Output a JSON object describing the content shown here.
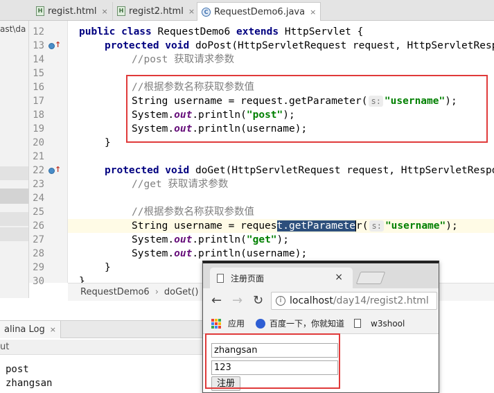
{
  "ide": {
    "tabs": [
      {
        "label": "regist.html",
        "type": "H"
      },
      {
        "label": "regist2.html",
        "type": "H"
      },
      {
        "label": "RequestDemo6.java",
        "type": "C"
      }
    ],
    "tab_close": "×",
    "project_path_stub": "ast\\da",
    "breadcrumb": {
      "class_name": "RequestDemo6",
      "separator": "›",
      "method": "doGet()"
    },
    "console": {
      "tab_label": "alina Log",
      "tab_close": "×",
      "header": "ut",
      "output": [
        "post",
        "zhangsan"
      ]
    }
  },
  "code": {
    "line_numbers": [
      "12",
      "13",
      "14",
      "15",
      "16",
      "17",
      "18",
      "19",
      "20",
      "21",
      "22",
      "23",
      "24",
      "25",
      "26",
      "27",
      "28",
      "29",
      "30"
    ],
    "l12": {
      "kw1": "public class",
      "cls": " RequestDemo6 ",
      "kw2": "extends",
      "rest": " HttpServlet {"
    },
    "l13": {
      "kw": "protected void",
      "rest": " doPost(HttpServletRequest request, HttpServletResponse response)"
    },
    "l14": {
      "comment": "//post 获取请求参数"
    },
    "l16": {
      "comment": "//根据参数名称获取参数值"
    },
    "l17": {
      "a": "String username = request.getParameter(",
      "hint": "s:",
      "str": "\"username\"",
      "b": ");"
    },
    "l18": {
      "a": "System.",
      "field": "out",
      "b": ".println(",
      "str": "\"post\"",
      "c": ");"
    },
    "l19": {
      "a": "System.",
      "field": "out",
      "b": ".println(username);"
    },
    "l20": {
      "brace": "}"
    },
    "l22": {
      "kw": "protected void",
      "rest": " doGet(HttpServletRequest request, HttpServletResponse response)"
    },
    "l23": {
      "comment": "//get 获取请求参数"
    },
    "l25": {
      "comment": "//根据参数名称获取参数值"
    },
    "l26": {
      "a": "String username = reques",
      "sel": "t.getParamete",
      "b": "r(",
      "hint": "s:",
      "str": "\"username\"",
      "c": ");"
    },
    "l27": {
      "a": "System.",
      "field": "out",
      "b": ".println(",
      "str": "\"get\"",
      "c": ");"
    },
    "l28": {
      "a": "System.",
      "field": "out",
      "b": ".println(username);"
    },
    "l29": {
      "brace": "}"
    },
    "l30": {
      "brace": "}"
    }
  },
  "browser": {
    "tab_title": "注册页面",
    "tab_close": "×",
    "back": "←",
    "forward": "→",
    "reload": "↻",
    "info": "i",
    "url_host": "localhost",
    "url_path": "/day14/regist2.html",
    "bookmarks": [
      "应用",
      "百度一下，你就知道",
      "w3shool"
    ],
    "form": {
      "username": "zhangsan",
      "password": "123",
      "submit": "注册"
    },
    "colors": {
      "apps": [
        "#e94235",
        "#fbbc04",
        "#34a853",
        "#4285f4",
        "#e94235",
        "#fbbc04",
        "#34a853",
        "#4285f4",
        "#e94235"
      ]
    }
  },
  "annotations": {
    "box_color": "#e03a3a"
  }
}
